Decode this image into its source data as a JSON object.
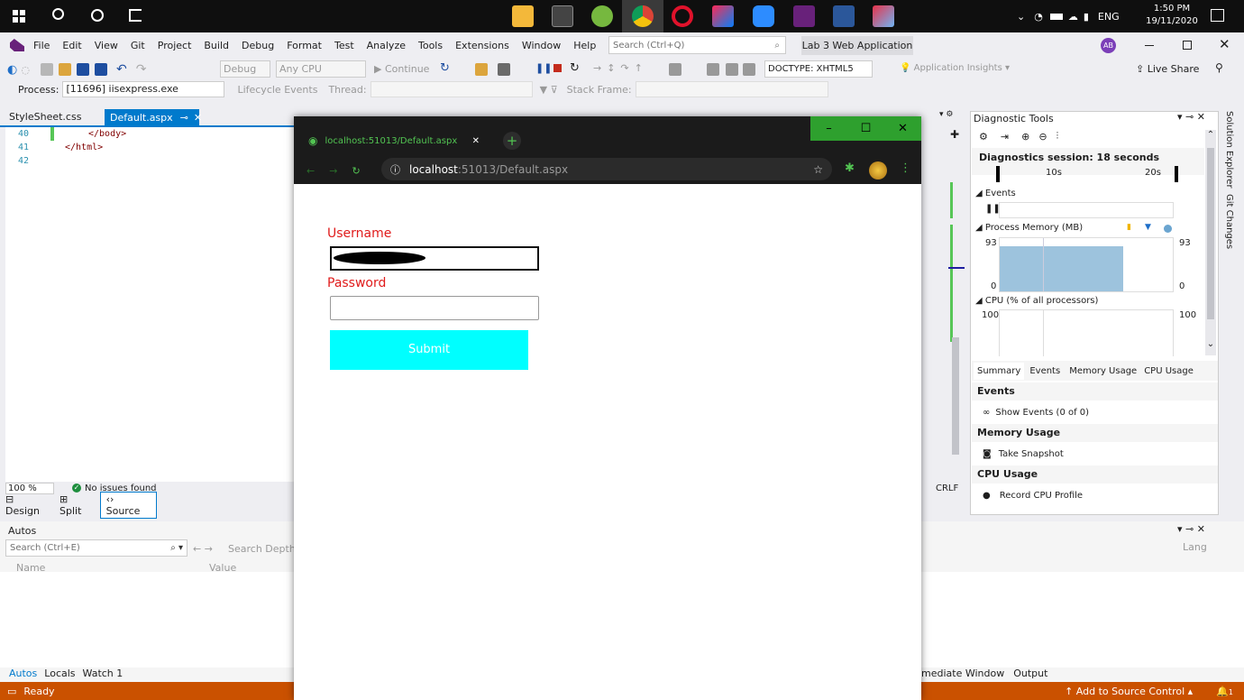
{
  "taskbar": {
    "lang": "ENG",
    "time": "1:50 PM",
    "date": "19/11/2020"
  },
  "vs": {
    "menu": [
      "File",
      "Edit",
      "View",
      "Git",
      "Project",
      "Build",
      "Debug",
      "Format",
      "Test",
      "Analyze",
      "Tools",
      "Extensions",
      "Window",
      "Help"
    ],
    "search_placeholder": "Search (Ctrl+Q)",
    "solution_title": "Lab 3 Web Application",
    "avatar": "AB",
    "toolbar": {
      "config": "Debug",
      "platform": "Any CPU",
      "continue": "Continue",
      "doctype": "DOCTYPE: XHTML5",
      "insights": "Application Insights",
      "live_share": "Live Share"
    },
    "debugbar": {
      "process_label": "Process:",
      "process_value": "[11696] iisexpress.exe",
      "lifecycle": "Lifecycle Events",
      "thread": "Thread:",
      "stack": "Stack Frame:"
    },
    "tabs": {
      "tab1": "StyleSheet.css",
      "tab2": "Default.aspx"
    },
    "code": {
      "l40": "40",
      "l41": "41",
      "l42": "42",
      "c40": "</body>",
      "c41": "</html>"
    },
    "status_editor": {
      "zoom": "100 %",
      "issues": "No issues found",
      "crlf": "CRLF"
    },
    "viewtabs": {
      "design": "Design",
      "split": "Split",
      "source": "Source"
    },
    "autos": {
      "title": "Autos",
      "search": "Search (Ctrl+E)",
      "depth": "Search Depth:",
      "col_name": "Name",
      "col_value": "Value",
      "col_lang": "Lang",
      "tabs": [
        "Autos",
        "Locals",
        "Watch 1"
      ],
      "right_tabs": [
        "mediate Window",
        "Output"
      ]
    },
    "statusbar": {
      "ready": "Ready",
      "source_control": "Add to Source Control",
      "notif": "1"
    },
    "side_tabs": {
      "solution": "Solution Explorer",
      "git": "Git Changes"
    }
  },
  "diagnostic": {
    "title": "Diagnostic Tools",
    "session": "Diagnostics session: 18 seconds",
    "tick1": "10s",
    "tick2": "20s",
    "events_label": "Events",
    "memory_label": "Process Memory (MB)",
    "mem_top": "93",
    "mem_bottom": "0",
    "cpu_label": "CPU (% of all processors)",
    "cpu_top": "100",
    "tabs": [
      "Summary",
      "Events",
      "Memory Usage",
      "CPU Usage"
    ],
    "sec_events": "Events",
    "show_events": "Show Events (0 of 0)",
    "sec_memory": "Memory Usage",
    "take_snapshot": "Take Snapshot",
    "sec_cpu": "CPU Usage",
    "record_cpu": "Record CPU Profile",
    "memory_fill": 0.85
  },
  "browser": {
    "tab_title": "localhost:51013/Default.aspx",
    "url_host": "localhost",
    "url_rest": ":51013/Default.aspx",
    "form": {
      "username_label": "Username",
      "password_label": "Password",
      "submit_label": "Submit"
    }
  },
  "colors": {
    "vs_accent": "#007acc",
    "statusbar": "#ca5100",
    "submit_bg": "#00ffff",
    "label_red": "#e01b1b",
    "browser_green": "#2ea02e"
  }
}
